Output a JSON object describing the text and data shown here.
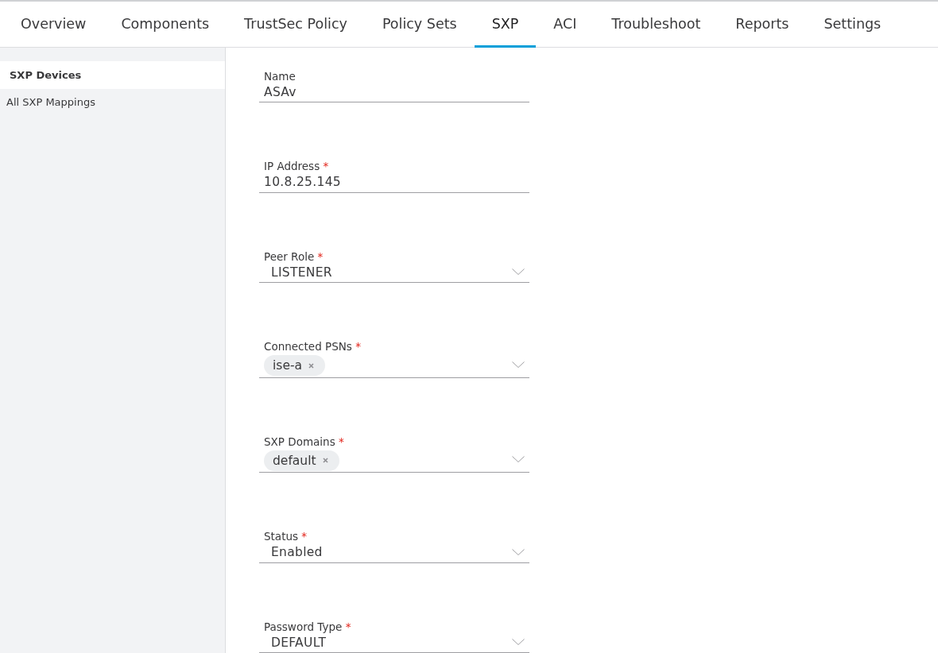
{
  "tabs": [
    {
      "label": "Overview",
      "selected": false
    },
    {
      "label": "Components",
      "selected": false
    },
    {
      "label": "TrustSec Policy",
      "selected": false
    },
    {
      "label": "Policy Sets",
      "selected": false
    },
    {
      "label": "SXP",
      "selected": true
    },
    {
      "label": "ACI",
      "selected": false
    },
    {
      "label": "Troubleshoot",
      "selected": false
    },
    {
      "label": "Reports",
      "selected": false
    },
    {
      "label": "Settings",
      "selected": false
    }
  ],
  "sidebar": {
    "items": [
      {
        "label": "SXP Devices",
        "selected": true
      },
      {
        "label": "All SXP Mappings",
        "selected": false
      }
    ]
  },
  "form": {
    "fields": [
      {
        "kind": "text",
        "label": "Name",
        "value": "ASAv"
      },
      {
        "kind": "text",
        "label": "IP Address",
        "required_mark": "*",
        "value": "10.8.25.145"
      },
      {
        "kind": "select",
        "label": "Peer Role",
        "required_mark": "*",
        "value": "LISTENER"
      },
      {
        "kind": "tags",
        "label": "Connected PSNs",
        "required_mark": "*",
        "tags": [
          "ise-a"
        ]
      },
      {
        "kind": "tags",
        "label": "SXP Domains",
        "required_mark": "*",
        "tags": [
          "default"
        ]
      },
      {
        "kind": "select",
        "label": "Status",
        "required_mark": "*",
        "value": "Enabled"
      },
      {
        "kind": "select",
        "label": "Password Type",
        "required_mark": "*",
        "value": "DEFAULT"
      }
    ]
  }
}
